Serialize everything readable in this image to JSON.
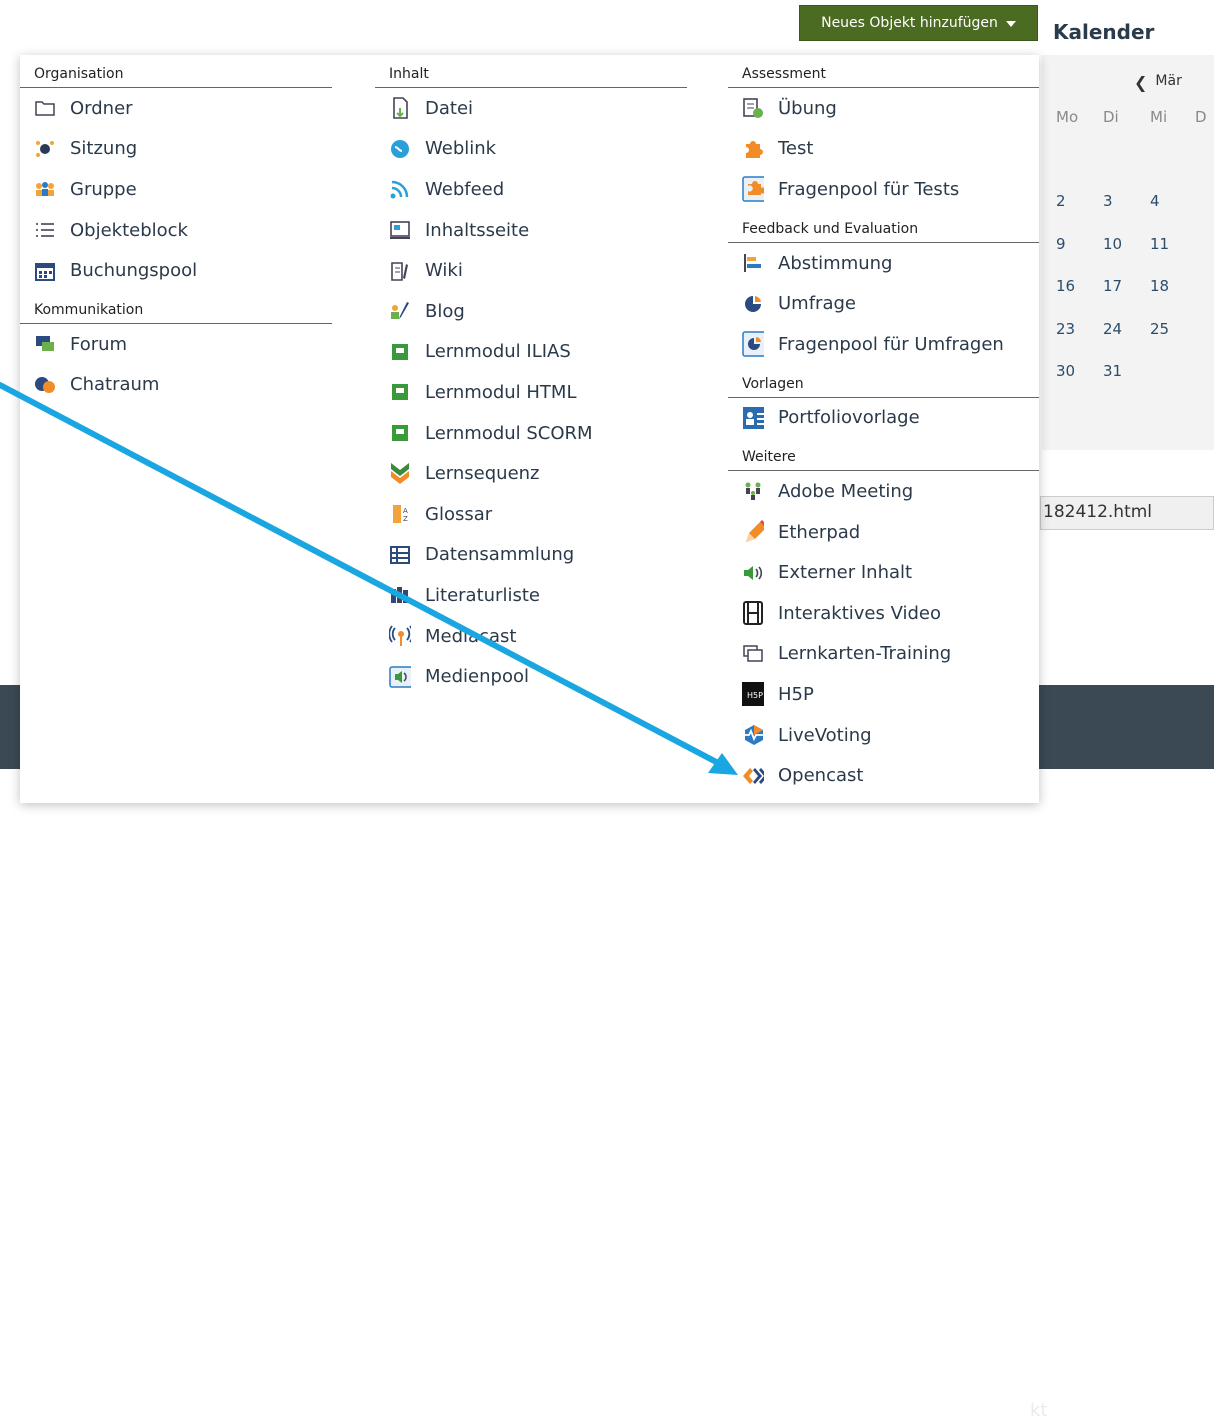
{
  "toolbar": {
    "add_button_label": "Neues Objekt hinzufügen"
  },
  "calendar": {
    "title": "Kalender",
    "month_label": "Mär",
    "weekdays": [
      "Mo",
      "Di",
      "Mi",
      "D"
    ],
    "weeks": [
      [
        "2",
        "3",
        "4",
        ""
      ],
      [
        "9",
        "10",
        "11",
        ""
      ],
      [
        "16",
        "17",
        "18",
        ""
      ],
      [
        "23",
        "24",
        "25",
        ""
      ],
      [
        "30",
        "31",
        "",
        ""
      ]
    ]
  },
  "file_field": {
    "value": "182412.html"
  },
  "footer": {
    "partial_text": "kt"
  },
  "dropdown": {
    "columns": [
      {
        "sections": [
          {
            "header": "Organisation",
            "items": [
              {
                "label": "Ordner",
                "icon": "folder-icon"
              },
              {
                "label": "Sitzung",
                "icon": "session-icon"
              },
              {
                "label": "Gruppe",
                "icon": "group-icon"
              },
              {
                "label": "Objekteblock",
                "icon": "list-icon"
              },
              {
                "label": "Buchungspool",
                "icon": "calendar-icon"
              }
            ]
          },
          {
            "header": "Kommunikation",
            "items": [
              {
                "label": "Forum",
                "icon": "forum-icon"
              },
              {
                "label": "Chatraum",
                "icon": "chat-icon"
              }
            ]
          }
        ]
      },
      {
        "sections": [
          {
            "header": "Inhalt",
            "items": [
              {
                "label": "Datei",
                "icon": "file-icon"
              },
              {
                "label": "Weblink",
                "icon": "weblink-icon"
              },
              {
                "label": "Webfeed",
                "icon": "rss-icon"
              },
              {
                "label": "Inhaltsseite",
                "icon": "content-page-icon"
              },
              {
                "label": "Wiki",
                "icon": "wiki-icon"
              },
              {
                "label": "Blog",
                "icon": "blog-icon"
              },
              {
                "label": "Lernmodul ILIAS",
                "icon": "module-icon"
              },
              {
                "label": "Lernmodul HTML",
                "icon": "module-icon"
              },
              {
                "label": "Lernmodul SCORM",
                "icon": "module-icon"
              },
              {
                "label": "Lernsequenz",
                "icon": "sequence-icon"
              },
              {
                "label": "Glossar",
                "icon": "glossary-icon"
              },
              {
                "label": "Datensammlung",
                "icon": "table-icon"
              },
              {
                "label": "Literaturliste",
                "icon": "literature-icon"
              },
              {
                "label": "Mediacast",
                "icon": "broadcast-icon"
              },
              {
                "label": "Medienpool",
                "icon": "media-pool-icon"
              }
            ]
          }
        ]
      },
      {
        "sections": [
          {
            "header": "Assessment",
            "items": [
              {
                "label": "Übung",
                "icon": "exercise-icon"
              },
              {
                "label": "Test",
                "icon": "puzzle-icon"
              },
              {
                "label": "Fragenpool für Tests",
                "icon": "puzzle-pool-icon"
              }
            ]
          },
          {
            "header": "Feedback und Evaluation",
            "items": [
              {
                "label": "Abstimmung",
                "icon": "bar-chart-icon"
              },
              {
                "label": "Umfrage",
                "icon": "survey-icon"
              },
              {
                "label": "Fragenpool für Umfragen",
                "icon": "survey-pool-icon"
              }
            ]
          },
          {
            "header": "Vorlagen",
            "items": [
              {
                "label": "Portfoliovorlage",
                "icon": "portfolio-icon"
              }
            ]
          },
          {
            "header": "Weitere",
            "items": [
              {
                "label": "Adobe Meeting",
                "icon": "meeting-icon"
              },
              {
                "label": "Etherpad",
                "icon": "pencil-icon"
              },
              {
                "label": "Externer Inhalt",
                "icon": "speaker-icon"
              },
              {
                "label": "Interaktives Video",
                "icon": "film-icon"
              },
              {
                "label": "Lernkarten-Training",
                "icon": "cards-icon"
              },
              {
                "label": "H5P",
                "icon": "h5p-icon"
              },
              {
                "label": "LiveVoting",
                "icon": "livevoting-icon"
              },
              {
                "label": "Opencast",
                "icon": "opencast-icon"
              }
            ]
          }
        ]
      }
    ]
  },
  "annotation": {
    "arrow_color": "#1aa6e0"
  }
}
